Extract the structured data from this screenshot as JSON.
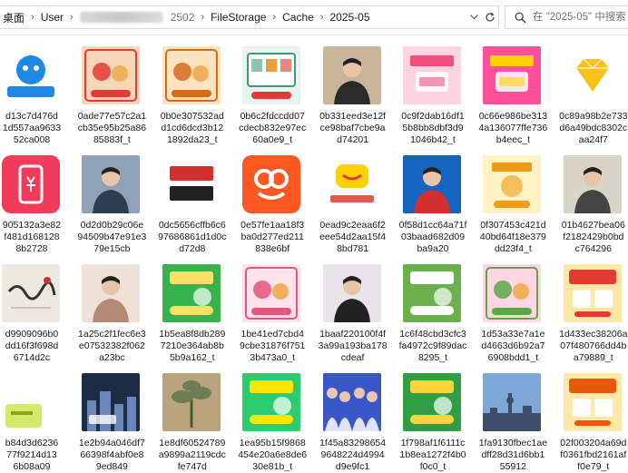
{
  "address_bar": {
    "crumbs": [
      "桌面",
      "User",
      "FileStorage",
      "Cache",
      "2025-05"
    ],
    "blurred_prefix": "",
    "blurred_suffix": "2502",
    "search_placeholder": "在 \"2025-05\" 中搜索"
  },
  "files": [
    {
      "name_lines": [
        "d13c7d476d",
        "1d557aa9633",
        "52ca008"
      ],
      "thumb": "app-logo-blue",
      "colors": [
        "#1e88e5",
        "#ffffff"
      ]
    },
    {
      "name_lines": [
        "0ade77e57c2a1",
        "cb35e95b25a86",
        "85883f_t"
      ],
      "thumb": "food-banner",
      "colors": [
        "#f5d6b8",
        "#e53935"
      ]
    },
    {
      "name_lines": [
        "0b0e307532ad",
        "d1cd6dcd3b12",
        "1892da23_t"
      ],
      "thumb": "food-banner",
      "colors": [
        "#fbe3c0",
        "#d86a1b"
      ]
    },
    {
      "name_lines": [
        "0b6c2fdccdd07",
        "cdecb832e97ec",
        "60a0e9_t"
      ],
      "thumb": "shop-banner",
      "colors": [
        "#e8f4f0",
        "#3a9d7c"
      ]
    },
    {
      "name_lines": [
        "0b331eed3e12f",
        "ce98baf7cbe9a",
        "d74201"
      ],
      "thumb": "person-photo",
      "colors": [
        "#c9b59a",
        "#2b2b2b"
      ]
    },
    {
      "name_lines": [
        "0c9f2dab16df1",
        "5b8bb8dbf3d9",
        "1046b42_t"
      ],
      "thumb": "promo-pink",
      "colors": [
        "#ffd3e0",
        "#f04e7c"
      ]
    },
    {
      "name_lines": [
        "0c66e986be313",
        "4a136077ffe736",
        "b4eec_t"
      ],
      "thumb": "promo-pink",
      "colors": [
        "#ff4f9a",
        "#ffd200"
      ]
    },
    {
      "name_lines": [
        "0c89a98b2e733",
        "d6a49bdc8302c",
        "aa24f7"
      ],
      "thumb": "diamond-icon",
      "colors": [
        "#ffffff",
        "#f7c21a"
      ]
    },
    {
      "name_lines": [
        "905132a3e82",
        "f481d168128",
        "8b2728"
      ],
      "thumb": "phone-icon",
      "colors": [
        "#f03b5b",
        "#ffffff"
      ]
    },
    {
      "name_lines": [
        "0d2d0b29c06e",
        "94509b47e91e3",
        "79e15cb"
      ],
      "thumb": "person-photo",
      "colors": [
        "#8fa2b8",
        "#2c3e50"
      ]
    },
    {
      "name_lines": [
        "0dc5656cffb6c6",
        "97686861d1d0c",
        "d72d8"
      ],
      "thumb": "text-banner",
      "colors": [
        "#ffffff",
        "#d32f2f"
      ]
    },
    {
      "name_lines": [
        "0e57fe1aa18f3",
        "ba0d277ed211",
        "838e6bf"
      ],
      "thumb": "app-logo-orange",
      "colors": [
        "#ff5722",
        "#ffffff"
      ]
    },
    {
      "name_lines": [
        "0ead9c2eaa6f2",
        "eee54d2aa15f4",
        "8bd781"
      ],
      "thumb": "meituan-logo",
      "colors": [
        "#ffd100",
        "#e53935"
      ]
    },
    {
      "name_lines": [
        "0f58d1cc64a71f",
        "03baad682d09",
        "ba9a20"
      ],
      "thumb": "person-photo",
      "colors": [
        "#1565c0",
        "#d32f2f"
      ]
    },
    {
      "name_lines": [
        "0f307453c421d",
        "40bd64f18e379",
        "dd23f4_t"
      ],
      "thumb": "promo-yellow",
      "colors": [
        "#fff3c4",
        "#f29b18"
      ]
    },
    {
      "name_lines": [
        "01b4627bea06",
        "f2182429b0bd",
        "c764296"
      ],
      "thumb": "person-photo",
      "colors": [
        "#d9d4c8",
        "#444444"
      ]
    },
    {
      "name_lines": [
        "d9909096b0",
        "dd16f3f698d",
        "6714d2c"
      ],
      "thumb": "calligraphy",
      "colors": [
        "#ede9e0",
        "#333333"
      ]
    },
    {
      "name_lines": [
        "1a25c2f1fec6e3",
        "e07532382f062",
        "a23bc"
      ],
      "thumb": "person-photo",
      "colors": [
        "#efe1d8",
        "#b38a74"
      ]
    },
    {
      "name_lines": [
        "1b5ea8f8db289",
        "7210e364ab8b",
        "5b9a162_t"
      ],
      "thumb": "promo-green",
      "colors": [
        "#37b24d",
        "#ffe066"
      ]
    },
    {
      "name_lines": [
        "1be41ed7cbd4",
        "9cbe31876f751",
        "3b473a0_t"
      ],
      "thumb": "food-banner",
      "colors": [
        "#ffe3ec",
        "#e75480"
      ]
    },
    {
      "name_lines": [
        "1baaf220100f4f",
        "3a99a193ba178",
        "cdeaf"
      ],
      "thumb": "person-photo",
      "colors": [
        "#e9e4ea",
        "#222222"
      ]
    },
    {
      "name_lines": [
        "1c6f48cbd3cfc3",
        "fa4972c9f89dac",
        "8295_t"
      ],
      "thumb": "promo-green",
      "colors": [
        "#6ab04c",
        "#ffffff"
      ]
    },
    {
      "name_lines": [
        "1d53a33e7a1e",
        "d4663d6b92a7",
        "6908bdd1_t"
      ],
      "thumb": "food-banner",
      "colors": [
        "#ffd7e4",
        "#5aa846"
      ]
    },
    {
      "name_lines": [
        "1d433ec38206a",
        "07f480766dd4b",
        "a79889_t"
      ],
      "thumb": "promo-red",
      "colors": [
        "#ffe8a3",
        "#e53935"
      ]
    },
    {
      "name_lines": [
        "b84d3d6236",
        "77f9214d13",
        "6b08a09"
      ],
      "thumb": "tag-green",
      "colors": [
        "#d4e86b",
        "#8aa51a"
      ]
    },
    {
      "name_lines": [
        "1e2b94a046df7",
        "66398f4abf0e8",
        "9ed849"
      ],
      "thumb": "city-photo",
      "colors": [
        "#1d2b45",
        "#6a86b8"
      ]
    },
    {
      "name_lines": [
        "1e8df60524789",
        "a9899a2119cdc",
        "fe747d"
      ],
      "thumb": "plant-photo",
      "colors": [
        "#6d7d55",
        "#b9a47d"
      ]
    },
    {
      "name_lines": [
        "1ea95b15f9868",
        "454e20a6e8de6",
        "30e81b_t"
      ],
      "thumb": "promo-green",
      "colors": [
        "#2ecc71",
        "#ffe600"
      ]
    },
    {
      "name_lines": [
        "1f45a83298654",
        "9648224d4994",
        "d9e9fc1"
      ],
      "thumb": "group-photo",
      "colors": [
        "#3a57c8",
        "#e9c6b4"
      ]
    },
    {
      "name_lines": [
        "1f798af1f6111c",
        "1b8ea1272f4b0",
        "f0c0_t"
      ],
      "thumb": "promo-green",
      "colors": [
        "#2f9e44",
        "#ffd43b"
      ]
    },
    {
      "name_lines": [
        "1fa9130fbec1ae",
        "dff28d31d6bb1",
        "55912"
      ],
      "thumb": "skyline-photo",
      "colors": [
        "#7fa7d8",
        "#3d4d6a"
      ]
    },
    {
      "name_lines": [
        "02f003204a69d",
        "f0361fbd2161af",
        "f0e79_t"
      ],
      "thumb": "promo-red",
      "colors": [
        "#ffe9a8",
        "#e8590c"
      ]
    }
  ]
}
